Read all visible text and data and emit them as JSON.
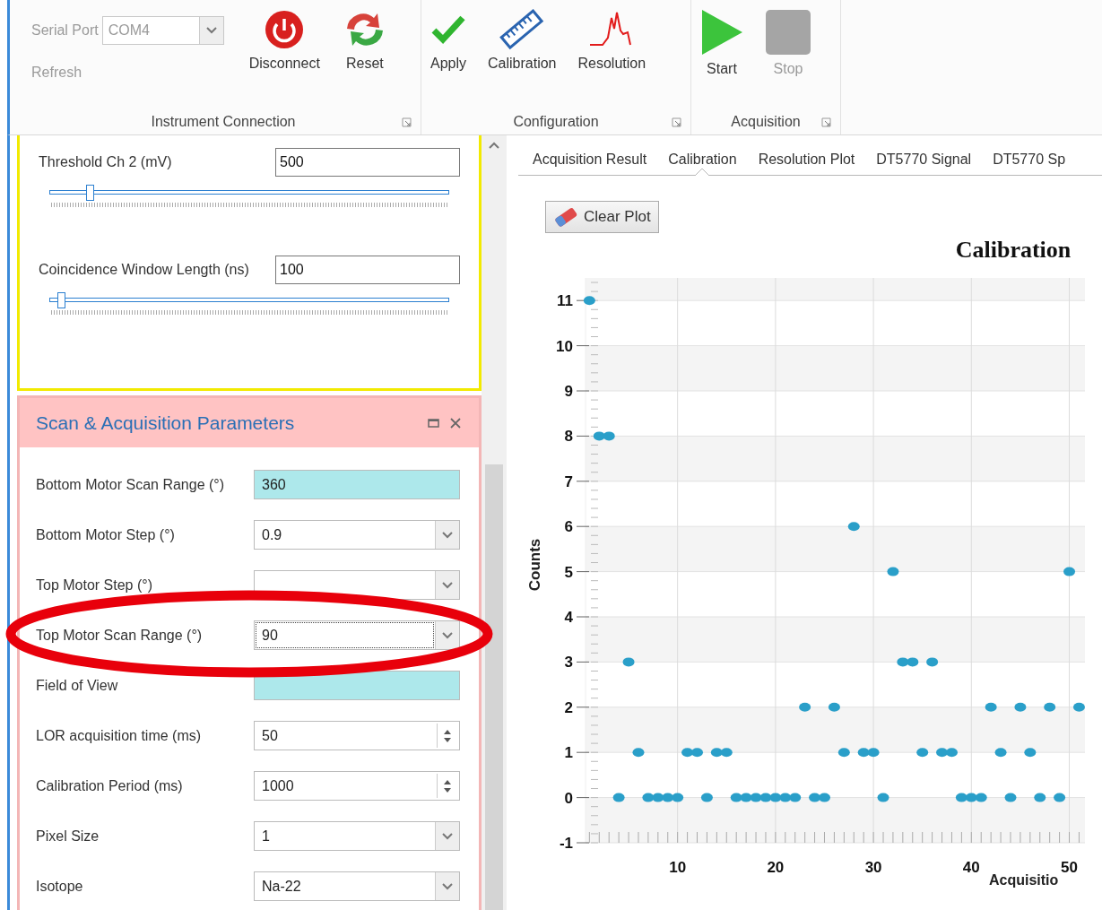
{
  "ribbon": {
    "groups": [
      {
        "label": "Instrument Connection",
        "items": [
          {
            "kind": "combo",
            "label": "Serial Port",
            "value": "COM4",
            "disabled": true
          },
          {
            "kind": "link",
            "label": "Refresh",
            "disabled": true
          },
          {
            "kind": "button",
            "label": "Disconnect",
            "disabled": false
          },
          {
            "kind": "button",
            "label": "Reset",
            "disabled": false
          }
        ]
      },
      {
        "label": "Configuration",
        "items": [
          {
            "kind": "button",
            "label": "Apply",
            "disabled": false
          },
          {
            "kind": "button",
            "label": "Calibration",
            "disabled": false
          },
          {
            "kind": "button",
            "label": "Resolution",
            "disabled": false
          }
        ]
      },
      {
        "label": "Acquisition",
        "items": [
          {
            "kind": "button",
            "label": "Start",
            "disabled": false
          },
          {
            "kind": "button",
            "label": "Stop",
            "disabled": true
          }
        ]
      }
    ]
  },
  "threshold_panel": {
    "fields": [
      {
        "label": "Threshold Ch 2 (mV)",
        "value": "500",
        "level": 0.1
      },
      {
        "label": "Coincidence Window Length (ns)",
        "value": "100",
        "level": 0.03
      }
    ]
  },
  "scan_panel": {
    "title": "Scan & Acquisition Parameters",
    "fields": [
      {
        "kind": "readonly",
        "label": "Bottom Motor Scan Range (°)",
        "value": "360",
        "focused": false
      },
      {
        "kind": "combo",
        "label": "Bottom Motor Step (°)",
        "value": "0.9",
        "focused": false
      },
      {
        "kind": "combo",
        "label": "Top Motor Step (°)",
        "focused": false
      },
      {
        "kind": "combo",
        "label": "Top Motor Scan Range (°)",
        "value": "90",
        "focused": true
      },
      {
        "kind": "readonly",
        "label": "Field of View",
        "focused": false
      },
      {
        "kind": "spin",
        "label": "LOR acquisition time (ms)",
        "value": "50",
        "focused": false
      },
      {
        "kind": "spin",
        "label": "Calibration Period (ms)",
        "value": "1000",
        "focused": false
      },
      {
        "kind": "combo",
        "label": "Pixel Size",
        "value": "1",
        "focused": false
      },
      {
        "kind": "combo",
        "label": "Isotope",
        "value": "Na-22",
        "focused": false
      }
    ]
  },
  "tabs": [
    {
      "label": "Acquisition Result",
      "selected": false
    },
    {
      "label": "Calibration",
      "selected": true
    },
    {
      "label": "Resolution Plot",
      "selected": false
    },
    {
      "label": "DT5770 Signal",
      "selected": false
    },
    {
      "label": "DT5770 Sp",
      "selected": false
    }
  ],
  "clear_button": "Clear Plot",
  "chart_data": {
    "type": "scatter",
    "title": "Calibration",
    "xlabel": "Acquisitio",
    "ylabel": "Counts",
    "x": [
      1,
      2,
      3,
      4,
      5,
      6,
      7,
      8,
      9,
      10,
      11,
      12,
      13,
      14,
      15,
      16,
      17,
      18,
      19,
      20,
      21,
      22,
      23,
      24,
      25,
      26,
      27,
      28,
      29,
      30,
      31,
      32,
      33,
      34,
      35,
      36,
      37,
      38,
      39,
      40,
      41,
      42,
      43,
      44,
      45,
      46,
      47,
      48,
      49,
      50,
      51
    ],
    "grid": true,
    "series": [
      {
        "color": "#2a9fc9",
        "values": [
          11,
          8,
          8,
          0,
          3,
          1,
          0,
          0,
          0,
          0,
          1,
          1,
          0,
          1,
          1,
          0,
          0,
          0,
          0,
          0,
          0,
          0,
          2,
          0,
          0,
          2,
          1,
          6,
          1,
          1,
          0,
          5,
          3,
          3,
          1,
          3,
          1,
          1,
          0,
          0,
          0,
          2,
          1,
          0,
          2,
          1,
          0,
          2,
          0,
          5,
          2
        ]
      }
    ],
    "xlim": [
      0.6,
      51.6
    ],
    "ylim": [
      -1,
      11.5
    ],
    "xticks": [
      10,
      20,
      30,
      40,
      50
    ],
    "yticks": [
      -1,
      0,
      1,
      2,
      3,
      4,
      5,
      6,
      7,
      8,
      9,
      10,
      11
    ]
  }
}
